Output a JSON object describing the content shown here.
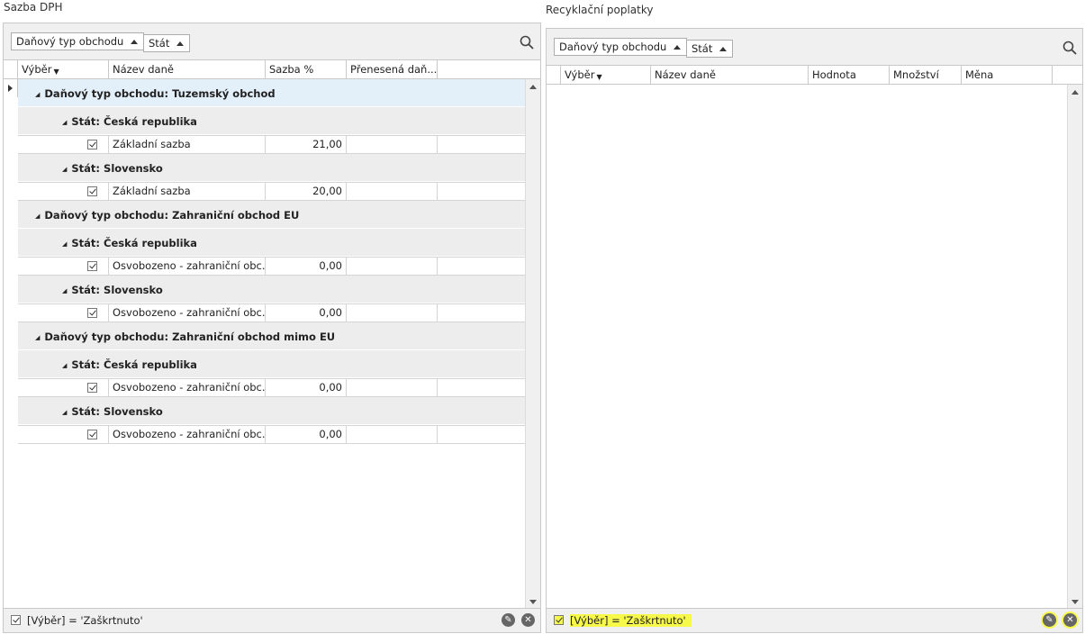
{
  "left": {
    "title": "Sazba DPH",
    "chips": [
      "Daňový typ obchodu",
      "Stát"
    ],
    "headers": [
      "Výběr",
      "Název daně",
      "Sazba %",
      "Přenesená daň..."
    ],
    "groups": [
      {
        "label": "Daňový typ obchodu: Tuzemský obchod",
        "sub": [
          {
            "label": "Stát: Česká republika",
            "name": "Základní sazba",
            "rate": "21,00"
          },
          {
            "label": "Stát: Slovensko",
            "name": "Základní sazba",
            "rate": "20,00"
          }
        ]
      },
      {
        "label": "Daňový typ obchodu: Zahraniční obchod EU",
        "sub": [
          {
            "label": "Stát: Česká republika",
            "name": "Osvobozeno - zahraniční obc...",
            "rate": "0,00"
          },
          {
            "label": "Stát: Slovensko",
            "name": "Osvobozeno - zahraniční obc...",
            "rate": "0,00"
          }
        ]
      },
      {
        "label": "Daňový typ obchodu: Zahraniční obchod mimo EU",
        "sub": [
          {
            "label": "Stát: Česká republika",
            "name": "Osvobozeno - zahraniční obc...",
            "rate": "0,00"
          },
          {
            "label": "Stát: Slovensko",
            "name": "Osvobozeno - zahraniční obc...",
            "rate": "0,00"
          }
        ]
      }
    ],
    "filter_text": "[Výběr] = 'Zaškrtnuto'"
  },
  "right": {
    "title": "Recyklační poplatky",
    "chips": [
      "Daňový typ obchodu",
      "Stát"
    ],
    "headers": [
      "Výběr",
      "Název daně",
      "Hodnota",
      "Množství",
      "Měna"
    ],
    "filter_text": "[Výběr] = 'Zaškrtnuto'"
  },
  "colors": {
    "highlight": "#f7f94a",
    "group_bg": "#ededed",
    "selected_group_bg": "#e3eff9"
  }
}
